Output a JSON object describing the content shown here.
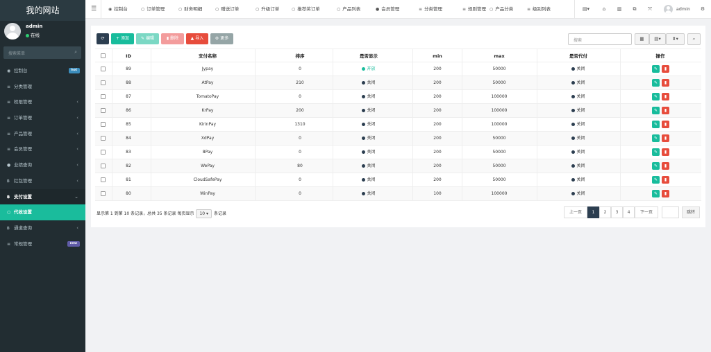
{
  "brand": "我的网站",
  "user": {
    "name": "admin",
    "status": "在线"
  },
  "sidebar": {
    "search_placeholder": "搜索菜单",
    "items": [
      {
        "label": "控制台",
        "icon": "dashboard-icon",
        "glyph": "◉",
        "badge": "hot",
        "badge_color": "#3c8dbc"
      },
      {
        "label": "分类管理",
        "icon": "list-icon",
        "glyph": "≡"
      },
      {
        "label": "权限管理",
        "icon": "list-icon",
        "glyph": "≡",
        "arrow": "‹"
      },
      {
        "label": "订单管理",
        "icon": "list-icon",
        "glyph": "≡",
        "arrow": "‹"
      },
      {
        "label": "产品管理",
        "icon": "list-icon",
        "glyph": "≡",
        "arrow": "‹"
      },
      {
        "label": "会员管理",
        "icon": "list-icon",
        "glyph": "≡",
        "arrow": "‹"
      },
      {
        "label": "业绩查询",
        "icon": "user-icon",
        "glyph": "●",
        "arrow": "‹"
      },
      {
        "label": "红包管理",
        "icon": "bitcoin-icon",
        "glyph": "฿",
        "arrow": "‹"
      },
      {
        "label": "支付设置",
        "icon": "bitcoin-icon",
        "glyph": "฿",
        "arrow": "⌄",
        "state": "open"
      },
      {
        "label": "代收设置",
        "icon": "circle-icon",
        "glyph": "○",
        "state": "active"
      },
      {
        "label": "通道查询",
        "icon": "bitcoin-icon",
        "glyph": "฿",
        "arrow": "‹"
      },
      {
        "label": "常规管理",
        "icon": "list-icon",
        "glyph": "≡",
        "badge": "new",
        "badge_color": "#605ca8"
      }
    ]
  },
  "topnav": {
    "tabs": [
      {
        "label": "控制台",
        "icon": "dashboard-icon",
        "glyph": "◉"
      },
      {
        "label": "订单管理",
        "icon": "circle-icon",
        "glyph": "○"
      },
      {
        "label": "财务明细",
        "icon": "circle-icon",
        "glyph": "○"
      },
      {
        "label": "赠送订单",
        "icon": "circle-icon",
        "glyph": "○"
      },
      {
        "label": "升级订单",
        "icon": "circle-icon",
        "glyph": "○"
      },
      {
        "label": "推荐奖订单",
        "icon": "circle-icon",
        "glyph": "○"
      },
      {
        "label": "产品列表",
        "icon": "circle-icon",
        "glyph": "○"
      },
      {
        "label": "会员管理",
        "icon": "user-icon",
        "glyph": "●"
      },
      {
        "label": "分类管理",
        "icon": "list-icon",
        "glyph": "≡"
      },
      {
        "label": "规则管理",
        "icon": "list-icon",
        "glyph": "≡"
      },
      {
        "label": "产品分类",
        "icon": "circle-icon",
        "glyph": "○"
      },
      {
        "label": "级别列表",
        "icon": "list-icon",
        "glyph": "≡"
      }
    ],
    "admin_label": "admin"
  },
  "toolbar": {
    "refresh": "⟳",
    "add": "添加",
    "edit": "编辑",
    "delete": "删除",
    "import": "导入",
    "more": "更多",
    "search_placeholder": "搜索"
  },
  "table": {
    "columns": [
      "ID",
      "支付名称",
      "排序",
      "是否显示",
      "min",
      "max",
      "是否代付",
      "操作"
    ],
    "rows": [
      {
        "id": "89",
        "name": "Jypay",
        "sort": "0",
        "show": "开放",
        "show_on": true,
        "min": "200",
        "max": "50000",
        "payout": "关闭"
      },
      {
        "id": "88",
        "name": "AtPay",
        "sort": "210",
        "show": "关闭",
        "show_on": false,
        "min": "200",
        "max": "50000",
        "payout": "关闭"
      },
      {
        "id": "87",
        "name": "TomatoPay",
        "sort": "0",
        "show": "关闭",
        "show_on": false,
        "min": "200",
        "max": "100000",
        "payout": "关闭"
      },
      {
        "id": "86",
        "name": "KrPay",
        "sort": "200",
        "show": "关闭",
        "show_on": false,
        "min": "200",
        "max": "100000",
        "payout": "关闭"
      },
      {
        "id": "85",
        "name": "KirinPay",
        "sort": "1310",
        "show": "关闭",
        "show_on": false,
        "min": "200",
        "max": "100000",
        "payout": "关闭"
      },
      {
        "id": "84",
        "name": "XdPay",
        "sort": "0",
        "show": "关闭",
        "show_on": false,
        "min": "200",
        "max": "50000",
        "payout": "关闭"
      },
      {
        "id": "83",
        "name": "8Pay",
        "sort": "0",
        "show": "关闭",
        "show_on": false,
        "min": "200",
        "max": "50000",
        "payout": "关闭"
      },
      {
        "id": "82",
        "name": "WePay",
        "sort": "80",
        "show": "关闭",
        "show_on": false,
        "min": "200",
        "max": "50000",
        "payout": "关闭"
      },
      {
        "id": "81",
        "name": "CloudSafePay",
        "sort": "0",
        "show": "关闭",
        "show_on": false,
        "min": "200",
        "max": "50000",
        "payout": "关闭"
      },
      {
        "id": "80",
        "name": "WinPay",
        "sort": "0",
        "show": "关闭",
        "show_on": false,
        "min": "100",
        "max": "100000",
        "payout": "关闭"
      }
    ]
  },
  "pagination": {
    "info_before": "显示第 1 到第 10 条记录，总共 35 条记录 每页显示",
    "page_size": "10",
    "info_after": "条记录",
    "prev": "上一页",
    "pages": [
      "1",
      "2",
      "3",
      "4"
    ],
    "current": "1",
    "next": "下一页",
    "jump": "跳转"
  },
  "colors": {
    "sidebar_bg": "#222d32",
    "active": "#1abc9c",
    "add": "#18bc9c",
    "edit": "#7bd8c4",
    "delete": "#f39c9c",
    "import": "#e74c3c",
    "more": "#95a5a6",
    "refresh": "#2c3e50"
  }
}
